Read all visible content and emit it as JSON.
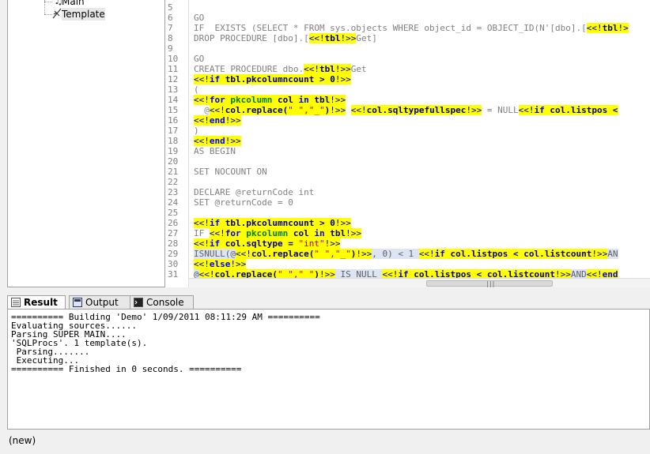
{
  "tree": {
    "items": [
      {
        "label": "Main",
        "icon": "music-note-icon"
      },
      {
        "label": "Template",
        "icon": "template-icon"
      }
    ]
  },
  "editor": {
    "lines": [
      {
        "n": "5",
        "segs": []
      },
      {
        "n": "6",
        "segs": [
          {
            "t": "GO",
            "c": ""
          }
        ]
      },
      {
        "n": "7",
        "segs": [
          {
            "t": "IF  EXISTS (SELECT * FROM sys.objects WHERE object_id = OBJECT_ID(N'[dbo].[",
            "c": ""
          },
          {
            "t": "<<!",
            "c": "hl"
          },
          {
            "t": "tbl",
            "c": "hl vv"
          },
          {
            "t": "!>",
            "c": "hl"
          }
        ]
      },
      {
        "n": "8",
        "segs": [
          {
            "t": "DROP PROCEDURE [dbo].[",
            "c": ""
          },
          {
            "t": "<<!",
            "c": "hl"
          },
          {
            "t": "tbl",
            "c": "hl vv"
          },
          {
            "t": "!>>",
            "c": "hl"
          },
          {
            "t": "Get]",
            "c": ""
          }
        ]
      },
      {
        "n": "9",
        "segs": []
      },
      {
        "n": "10",
        "segs": [
          {
            "t": "GO",
            "c": ""
          }
        ]
      },
      {
        "n": "11",
        "segs": [
          {
            "t": "CREATE PROCEDURE dbo.",
            "c": ""
          },
          {
            "t": "<<!",
            "c": "hl"
          },
          {
            "t": "tbl",
            "c": "hl vv"
          },
          {
            "t": "!>>",
            "c": "hl"
          },
          {
            "t": "Get",
            "c": ""
          }
        ]
      },
      {
        "n": "12",
        "segs": [
          {
            "t": "<<!",
            "c": "hl"
          },
          {
            "t": "if",
            "c": "hl kw"
          },
          {
            "t": " tbl.pkcolumncount > 0",
            "c": "hl vv"
          },
          {
            "t": "!>>",
            "c": "hl"
          }
        ]
      },
      {
        "n": "13",
        "segs": [
          {
            "t": "(",
            "c": ""
          }
        ]
      },
      {
        "n": "14",
        "segs": [
          {
            "t": "<<!",
            "c": "hl"
          },
          {
            "t": "for",
            "c": "hl kw"
          },
          {
            "t": " pkcolumn",
            "c": "hl gr"
          },
          {
            "t": " col ",
            "c": "hl vv"
          },
          {
            "t": "in",
            "c": "hl kw"
          },
          {
            "t": " tbl",
            "c": "hl vv"
          },
          {
            "t": "!>>",
            "c": "hl"
          }
        ]
      },
      {
        "n": "15",
        "segs": [
          {
            "t": "  @",
            "c": ""
          },
          {
            "t": "<<!",
            "c": "hl"
          },
          {
            "t": "col.replace(",
            "c": "hl vv"
          },
          {
            "t": "\" \",\"_\"",
            "c": "hl st"
          },
          {
            "t": ")",
            "c": "hl vv"
          },
          {
            "t": "!>>",
            "c": "hl"
          },
          {
            "t": " ",
            "c": ""
          },
          {
            "t": "<<!",
            "c": "hl"
          },
          {
            "t": "col.sqltypefullspec",
            "c": "hl vv"
          },
          {
            "t": "!>>",
            "c": "hl"
          },
          {
            "t": " = NULL",
            "c": ""
          },
          {
            "t": "<<!",
            "c": "hl"
          },
          {
            "t": "if",
            "c": "hl kw"
          },
          {
            "t": " col.listpos <",
            "c": "hl vv"
          }
        ]
      },
      {
        "n": "16",
        "segs": [
          {
            "t": "<<!",
            "c": "hl"
          },
          {
            "t": "end",
            "c": "hl kw"
          },
          {
            "t": "!>>",
            "c": "hl"
          }
        ]
      },
      {
        "n": "17",
        "segs": [
          {
            "t": ")",
            "c": ""
          }
        ]
      },
      {
        "n": "18",
        "segs": [
          {
            "t": "<<!",
            "c": "hl"
          },
          {
            "t": "end",
            "c": "hl kw"
          },
          {
            "t": "!>>",
            "c": "hl"
          }
        ]
      },
      {
        "n": "19",
        "segs": [
          {
            "t": "AS BEGIN",
            "c": ""
          }
        ]
      },
      {
        "n": "20",
        "segs": []
      },
      {
        "n": "21",
        "segs": [
          {
            "t": "SET NOCOUNT ON",
            "c": ""
          }
        ]
      },
      {
        "n": "22",
        "segs": []
      },
      {
        "n": "23",
        "segs": [
          {
            "t": "DECLARE @returnCode int",
            "c": ""
          }
        ]
      },
      {
        "n": "24",
        "segs": [
          {
            "t": "SET @returnCode = 0",
            "c": ""
          }
        ]
      },
      {
        "n": "25",
        "segs": []
      },
      {
        "n": "26",
        "segs": [
          {
            "t": "<<!",
            "c": "hl"
          },
          {
            "t": "if",
            "c": "hl kw"
          },
          {
            "t": " tbl.pkcolumncount > 0",
            "c": "hl vv"
          },
          {
            "t": "!>>",
            "c": "hl"
          }
        ]
      },
      {
        "n": "27",
        "segs": [
          {
            "t": "IF ",
            "c": ""
          },
          {
            "t": "<<!",
            "c": "hl"
          },
          {
            "t": "for",
            "c": "hl kw"
          },
          {
            "t": " pkcolumn",
            "c": "hl gr"
          },
          {
            "t": " col ",
            "c": "hl vv"
          },
          {
            "t": "in",
            "c": "hl kw"
          },
          {
            "t": " tbl",
            "c": "hl vv"
          },
          {
            "t": "!>>",
            "c": "hl"
          }
        ]
      },
      {
        "n": "28",
        "segs": [
          {
            "t": "<<!",
            "c": "hl"
          },
          {
            "t": "if",
            "c": "hl kw"
          },
          {
            "t": " col.sqltype = ",
            "c": "hl vv"
          },
          {
            "t": "\"int\"",
            "c": "hl st"
          },
          {
            "t": "!>>",
            "c": "hl"
          }
        ]
      },
      {
        "n": "29",
        "segs": [
          {
            "t": "ISNULL(@",
            "c": "sel"
          },
          {
            "t": "<<!",
            "c": "hl"
          },
          {
            "t": "col.replace(",
            "c": "hl vv"
          },
          {
            "t": "\" \",\"_\"",
            "c": "hl st"
          },
          {
            "t": ")",
            "c": "hl vv"
          },
          {
            "t": "!>>",
            "c": "hl"
          },
          {
            "t": ", 0) < 1 ",
            "c": "sel"
          },
          {
            "t": "<<!",
            "c": "hl"
          },
          {
            "t": "if",
            "c": "hl kw"
          },
          {
            "t": " col.listpos < col.listcount",
            "c": "hl vv"
          },
          {
            "t": "!>>",
            "c": "hl"
          },
          {
            "t": "AN",
            "c": "sel"
          }
        ]
      },
      {
        "n": "30",
        "segs": [
          {
            "t": "<<!",
            "c": "hl"
          },
          {
            "t": "else",
            "c": "hl kw"
          },
          {
            "t": "!>>",
            "c": "hl"
          }
        ]
      },
      {
        "n": "31",
        "segs": [
          {
            "t": "@",
            "c": "sel"
          },
          {
            "t": "<<!",
            "c": "hl"
          },
          {
            "t": "col.replace(",
            "c": "hl vv"
          },
          {
            "t": "\" \",\"_\"",
            "c": "hl st"
          },
          {
            "t": ")",
            "c": "hl vv"
          },
          {
            "t": "!>>",
            "c": "hl"
          },
          {
            "t": " IS NULL ",
            "c": "sel"
          },
          {
            "t": "<<!",
            "c": "hl"
          },
          {
            "t": "if",
            "c": "hl kw"
          },
          {
            "t": " col.listpos < col.listcount",
            "c": "hl vv"
          },
          {
            "t": "!>>",
            "c": "hl"
          },
          {
            "t": "AND",
            "c": "sel"
          },
          {
            "t": "<<!",
            "c": "hl"
          },
          {
            "t": "end",
            "c": "hl kw"
          }
        ]
      }
    ]
  },
  "tabs": [
    {
      "label": "Result",
      "icon": "result-icon",
      "active": true
    },
    {
      "label": "Output",
      "icon": "output-icon",
      "active": false
    },
    {
      "label": "Console",
      "icon": "console-icon",
      "active": false
    }
  ],
  "output_lines": [
    "========== Building 'Demo' 1/09/2011 08:11:29 AM ==========",
    "Evaluating sources......",
    "Parsing SUPER MAIN....",
    "'SQLProcs'. 1 template(s).",
    " Parsing.......",
    " Executing...",
    "========== Finished in 0 seconds. =========="
  ],
  "status": {
    "text": "(new)"
  }
}
